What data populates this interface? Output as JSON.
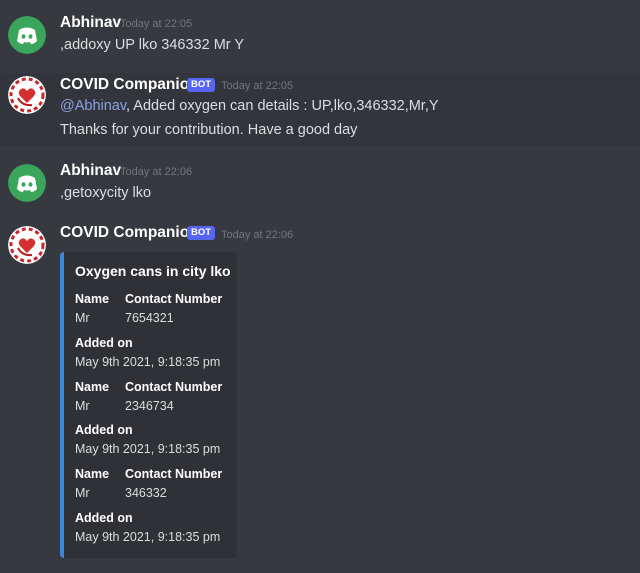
{
  "messages": [
    {
      "author": "Abhinav",
      "timestamp": "Today at 22:05",
      "lines": [
        ",addoxy UP lko 346332 Mr Y"
      ]
    },
    {
      "author": "COVID Companion",
      "bot_tag": "BOT",
      "timestamp": "Today at 22:05",
      "mention": "@Abhinav",
      "mention_rest": ", Added oxygen can details : UP,lko,346332,Mr,Y",
      "line2": "Thanks for your contribution. Have a good day"
    },
    {
      "author": "Abhinav",
      "timestamp": "Today at 22:06",
      "lines": [
        ",getoxycity lko"
      ]
    },
    {
      "author": "COVID Companion",
      "bot_tag": "BOT",
      "timestamp": "Today at 22:06",
      "embed": {
        "title": "Oxygen cans in city lko",
        "entries": [
          {
            "name_label": "Name",
            "name": "Mr",
            "contact_label": "Contact Number",
            "contact": "7654321",
            "added_label": "Added on",
            "added": "May 9th 2021, 9:18:35 pm"
          },
          {
            "name_label": "Name",
            "name": "Mr",
            "contact_label": "Contact Number",
            "contact": "2346734",
            "added_label": "Added on",
            "added": "May 9th 2021, 9:18:35 pm"
          },
          {
            "name_label": "Name",
            "name": "Mr",
            "contact_label": "Contact Number",
            "contact": "346332",
            "added_label": "Added on",
            "added": "May 9th 2021, 9:18:35 pm"
          }
        ]
      }
    }
  ],
  "colors": {
    "background": "#36393f",
    "highlight": "#32353b",
    "discord_avatar": "#3ba55c",
    "bot_tag": "#5865f2",
    "mention": "#8ea1e1",
    "embed_bar": "#3b89d8",
    "embed_bg": "#2f3136"
  },
  "icons": {
    "user_avatar": "discord-logo-icon",
    "bot_avatar": "covid-companion-logo-icon"
  }
}
